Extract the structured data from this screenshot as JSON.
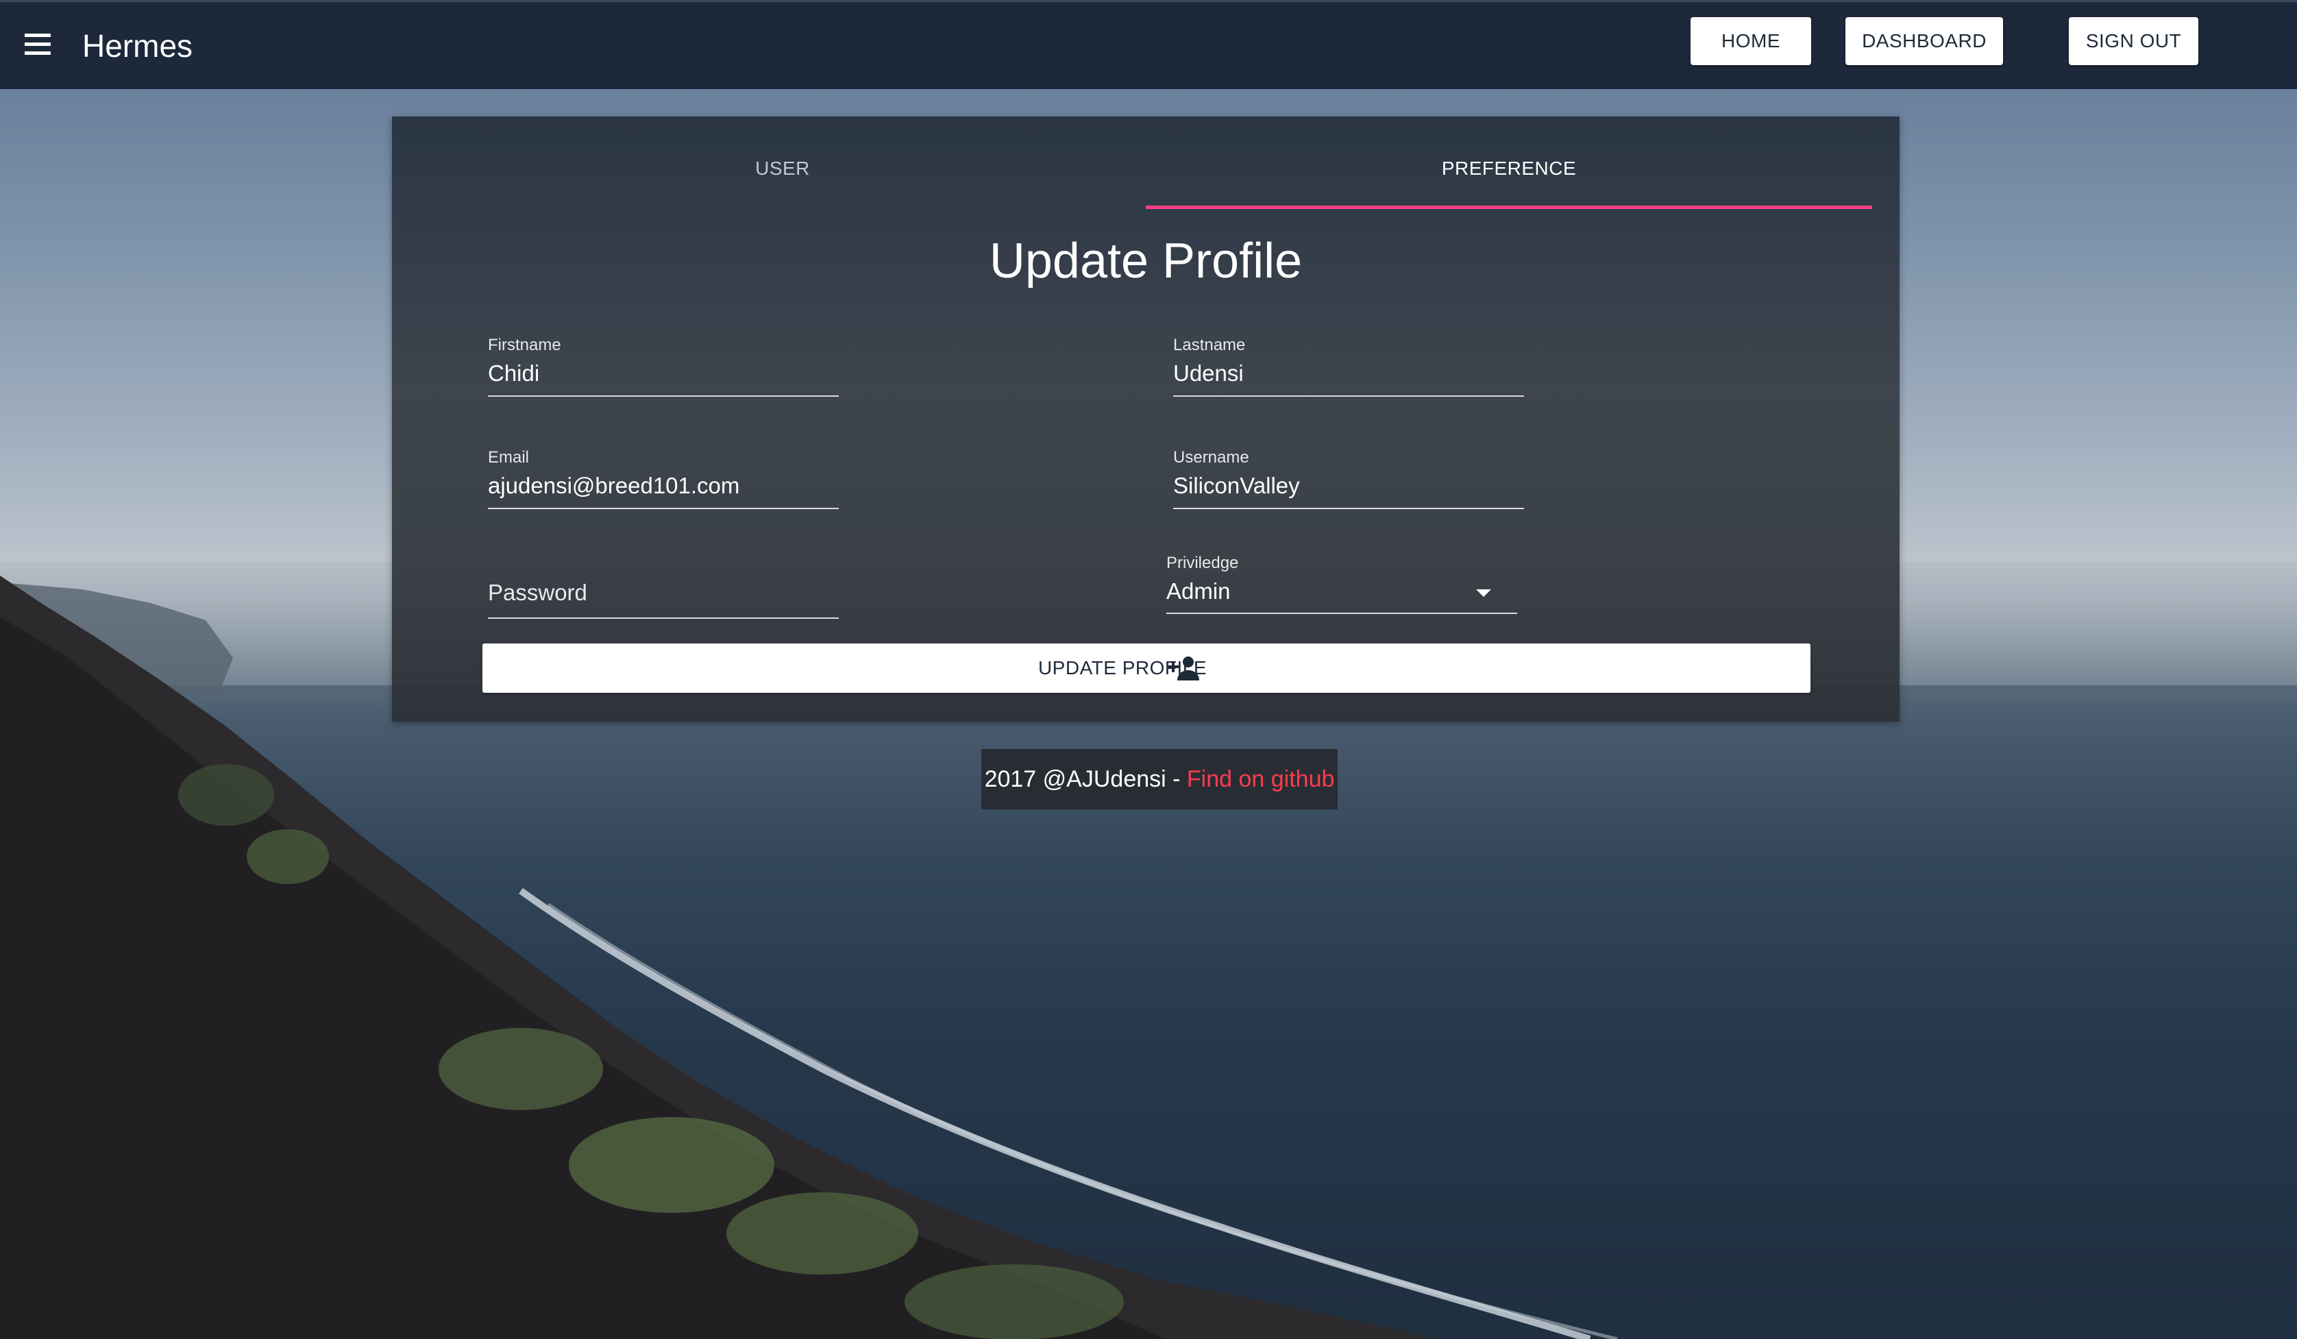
{
  "app": {
    "title": "Hermes",
    "menu_icon": "hamburger-menu-icon"
  },
  "nav": {
    "home": "HOME",
    "dashboard": "DASHBOARD",
    "sign_out": "SIGN OUT"
  },
  "tabs": [
    {
      "label": "USER",
      "active": false
    },
    {
      "label": "PREFERENCE",
      "active": true
    }
  ],
  "colors": {
    "accent": "#ff4081",
    "link": "#ff3b4e",
    "appbar": "#1d293a"
  },
  "form": {
    "title": "Update Profile",
    "firstname": {
      "label": "Firstname",
      "value": "Chidi"
    },
    "lastname": {
      "label": "Lastname",
      "value": "Udensi"
    },
    "email": {
      "label": "Email",
      "value": "ajudensi@breed101.com"
    },
    "username": {
      "label": "Username",
      "value": "SiliconValley"
    },
    "password": {
      "placeholder": "Password"
    },
    "privilege": {
      "label": "Priviledge",
      "value": "Admin"
    },
    "submit_label": "UPDATE PROFILE",
    "submit_icon": "person-add-icon"
  },
  "footer": {
    "text": "2017 @AJUdensi - ",
    "link": "Find on github"
  }
}
